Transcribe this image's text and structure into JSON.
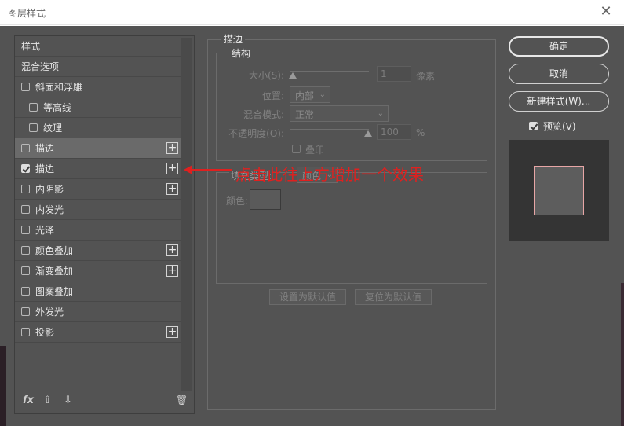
{
  "window": {
    "title": "图层样式",
    "close_glyph": "✕"
  },
  "styles_panel": {
    "items": [
      {
        "label": "样式",
        "has_checkbox": false,
        "checked": false,
        "has_add": false,
        "indent": false,
        "selected": false
      },
      {
        "label": "混合选项",
        "has_checkbox": false,
        "checked": false,
        "has_add": false,
        "indent": false,
        "selected": false
      },
      {
        "label": "斜面和浮雕",
        "has_checkbox": true,
        "checked": false,
        "has_add": false,
        "indent": false,
        "selected": false
      },
      {
        "label": "等高线",
        "has_checkbox": true,
        "checked": false,
        "has_add": false,
        "indent": true,
        "selected": false
      },
      {
        "label": "纹理",
        "has_checkbox": true,
        "checked": false,
        "has_add": false,
        "indent": true,
        "selected": false
      },
      {
        "label": "描边",
        "has_checkbox": true,
        "checked": false,
        "has_add": true,
        "indent": false,
        "selected": true
      },
      {
        "label": "描边",
        "has_checkbox": true,
        "checked": true,
        "has_add": true,
        "indent": false,
        "selected": false
      },
      {
        "label": "内阴影",
        "has_checkbox": true,
        "checked": false,
        "has_add": true,
        "indent": false,
        "selected": false
      },
      {
        "label": "内发光",
        "has_checkbox": true,
        "checked": false,
        "has_add": false,
        "indent": false,
        "selected": false
      },
      {
        "label": "光泽",
        "has_checkbox": true,
        "checked": false,
        "has_add": false,
        "indent": false,
        "selected": false
      },
      {
        "label": "颜色叠加",
        "has_checkbox": true,
        "checked": false,
        "has_add": true,
        "indent": false,
        "selected": false
      },
      {
        "label": "渐变叠加",
        "has_checkbox": true,
        "checked": false,
        "has_add": true,
        "indent": false,
        "selected": false
      },
      {
        "label": "图案叠加",
        "has_checkbox": true,
        "checked": false,
        "has_add": false,
        "indent": false,
        "selected": false
      },
      {
        "label": "外发光",
        "has_checkbox": true,
        "checked": false,
        "has_add": false,
        "indent": false,
        "selected": false
      },
      {
        "label": "投影",
        "has_checkbox": true,
        "checked": false,
        "has_add": true,
        "indent": false,
        "selected": false
      }
    ],
    "add_glyph": "+",
    "footer": {
      "fx": "fx",
      "up": "⇧",
      "down": "⇩",
      "trash": "🗑"
    }
  },
  "stroke": {
    "group_title": "描边",
    "structure_title": "结构",
    "size_label": "大小(S):",
    "size_value": "1",
    "size_unit": "像素",
    "position_label": "位置:",
    "position_value": "内部",
    "blend_label": "混合模式:",
    "blend_value": "正常",
    "opacity_label": "不透明度(O):",
    "opacity_value": "100",
    "opacity_unit": "%",
    "overprint_label": "叠印",
    "fill_type_label": "填充类型:",
    "fill_type_value": "颜色",
    "color_label": "颜色:",
    "make_default": "设置为默认值",
    "reset_default": "复位为默认值"
  },
  "annotation": {
    "text": "点击此往上方增加一个效果",
    "color": "#e0201f"
  },
  "buttons": {
    "ok": "确定",
    "cancel": "取消",
    "new_style": "新建样式(W)..."
  },
  "preview": {
    "label": "预览(V)",
    "checked": true
  },
  "colors": {
    "dialog_bg": "#535353",
    "accent_red": "#e0201f",
    "preview_bg": "#343434"
  }
}
